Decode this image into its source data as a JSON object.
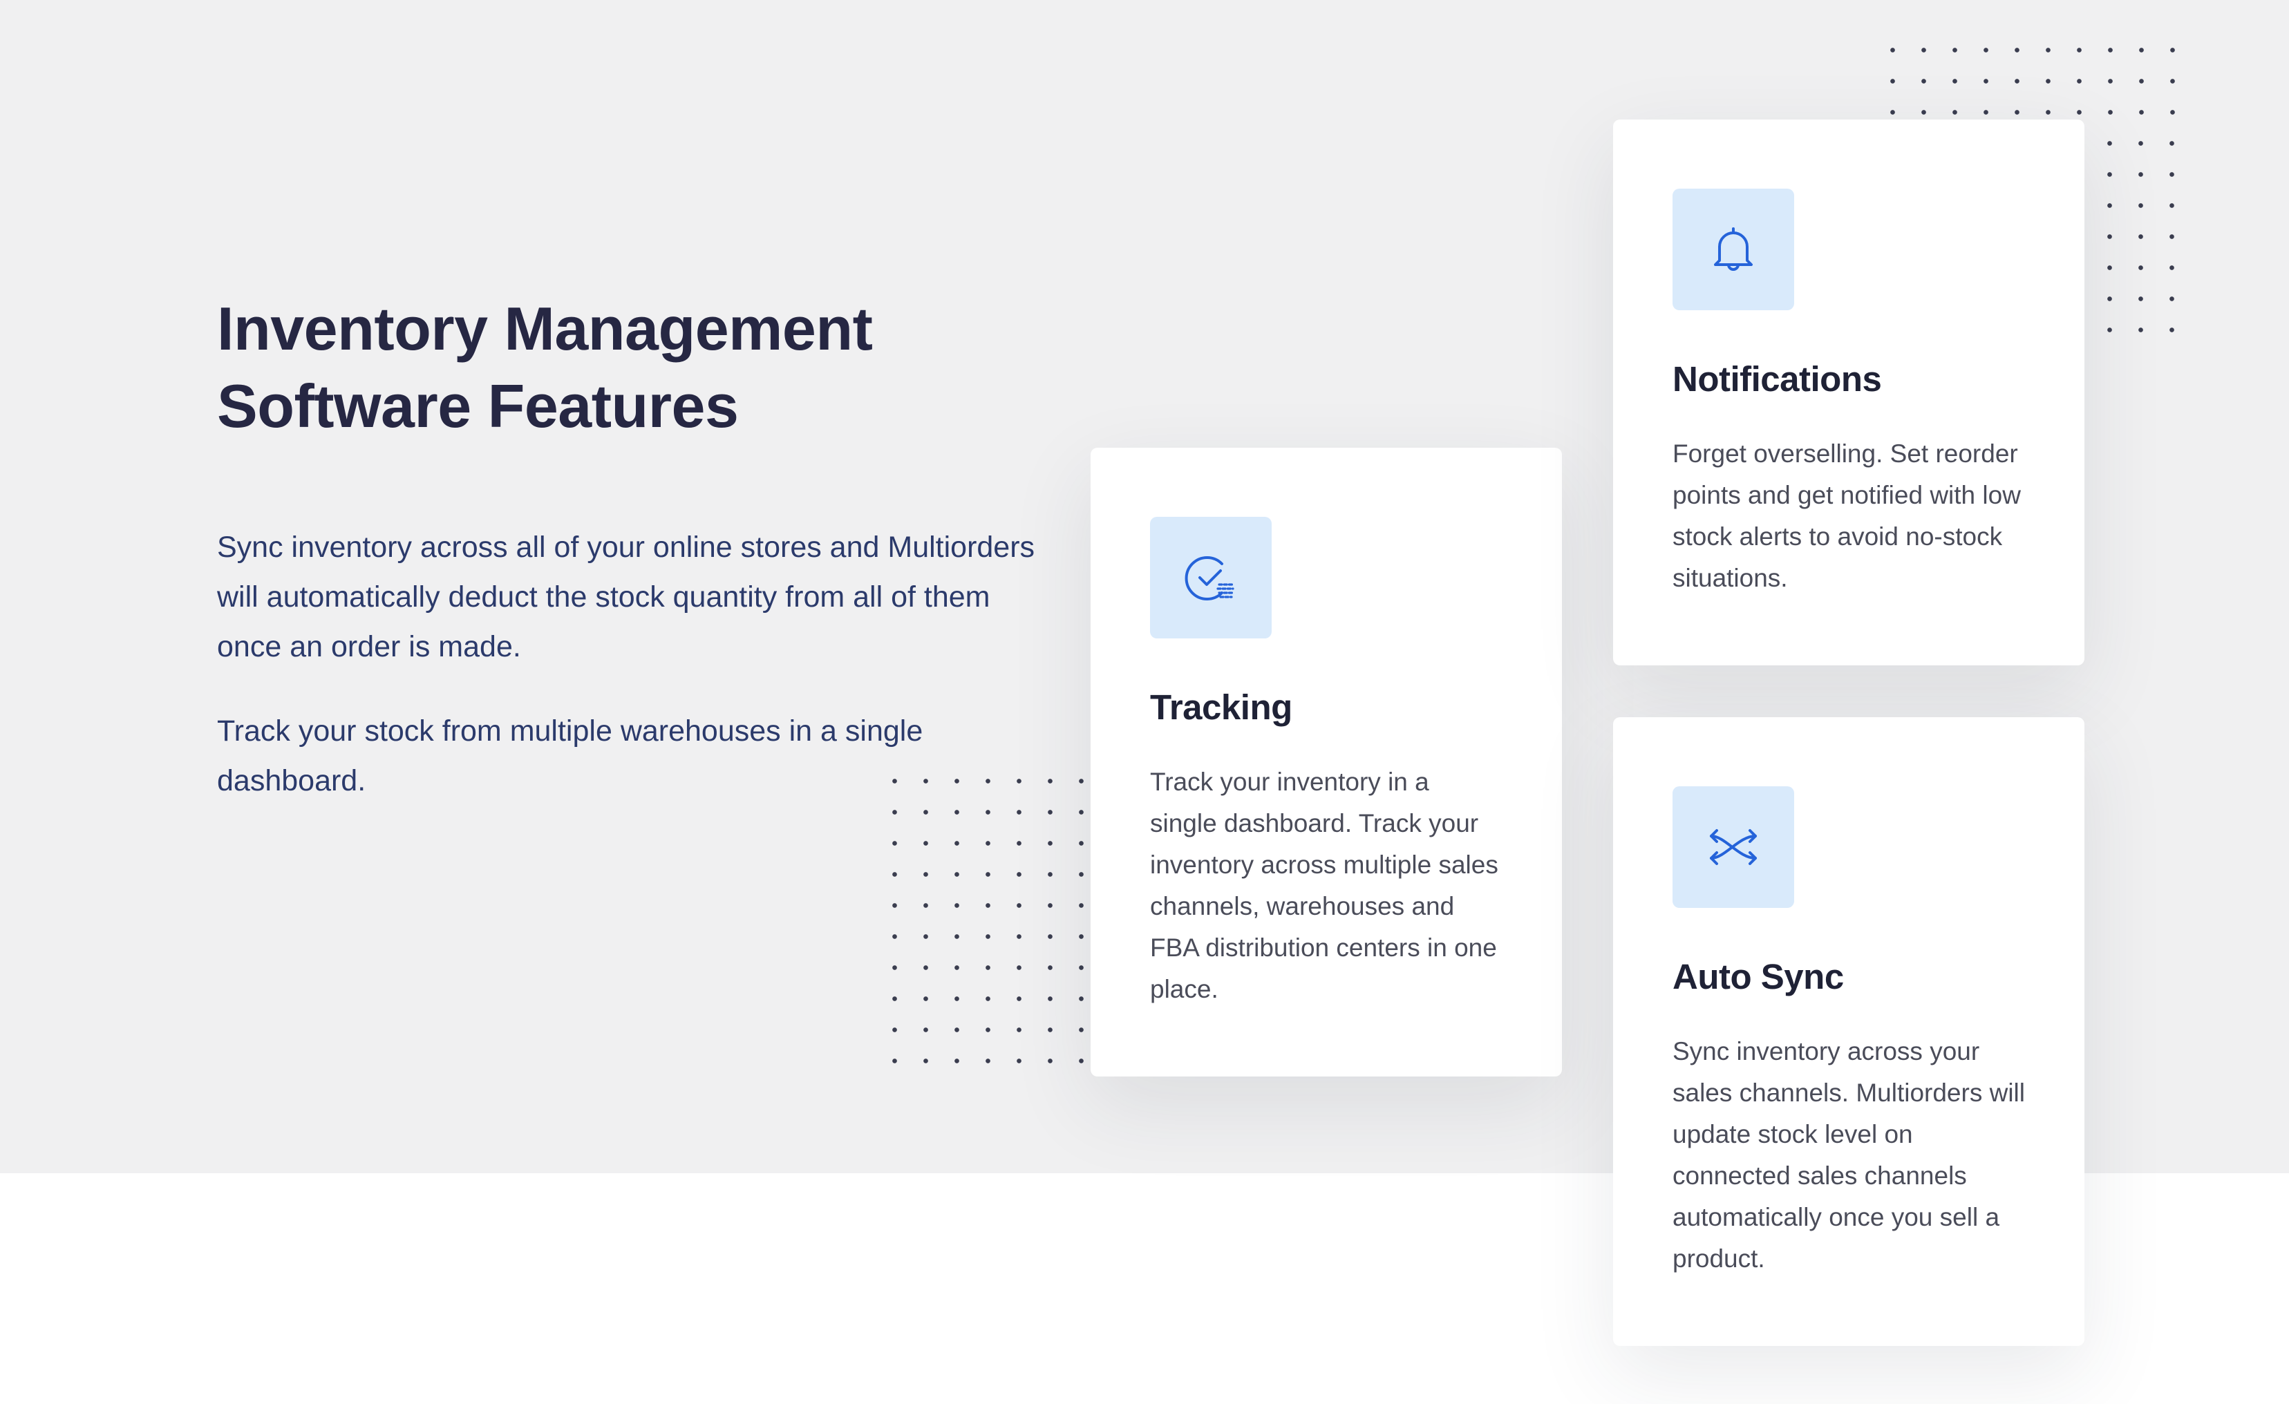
{
  "section": {
    "heading_line1": "Inventory Management",
    "heading_line2": "Software Features",
    "paragraph1": "Sync inventory across all of your online stores and Multiorders will automatically deduct the stock quantity from all of them once an order is made.",
    "paragraph2": "Track your stock from multiple warehouses in a single dashboard."
  },
  "cards": [
    {
      "icon": "clock-check-icon",
      "title": "Tracking",
      "text": "Track your inventory in a single dashboard. Track your inventory across multiple sales channels, warehouses and FBA distribution centers in one place."
    },
    {
      "icon": "bell-icon",
      "title": "Notifications",
      "text": "Forget overselling. Set reorder points and get notified with low stock alerts to avoid no-stock situations."
    },
    {
      "icon": "shuffle-icon",
      "title": "Auto Sync",
      "text": "Sync inventory across your sales channels. Multiorders will update stock level on connected sales channels automatically once you sell a product."
    }
  ],
  "colors": {
    "background_band": "#f0f0f1",
    "heading": "#262743",
    "intro_text": "#2b3a6b",
    "icon_accent": "#2563d9",
    "icon_tile": "#d9eafb"
  }
}
